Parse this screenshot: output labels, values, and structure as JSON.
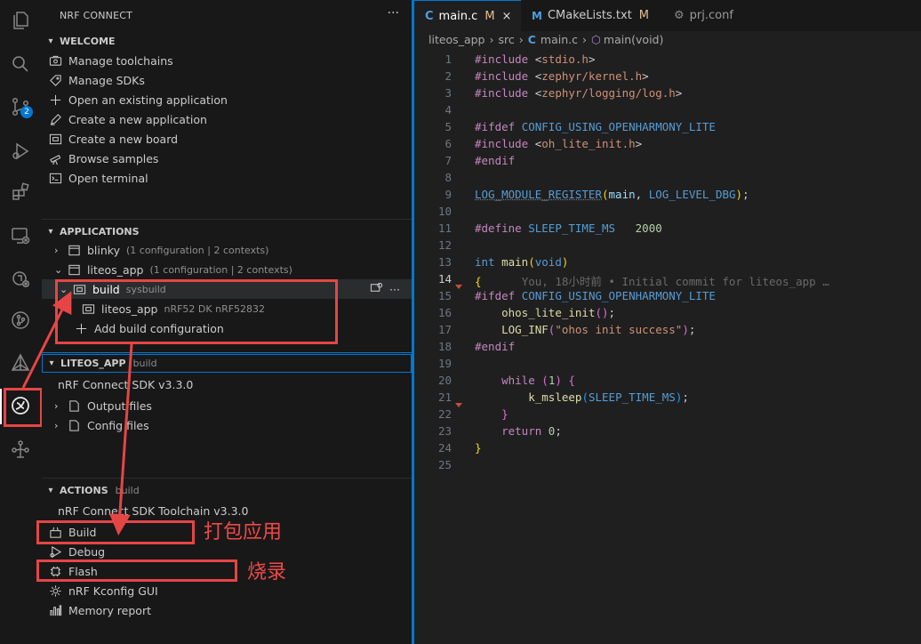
{
  "sidebar": {
    "title": "NRF CONNECT",
    "more": "···",
    "welcome": {
      "header": "WELCOME",
      "items": [
        "Manage toolchains",
        "Manage SDKs",
        "Open an existing application",
        "Create a new application",
        "Create a new board",
        "Browse samples",
        "Open terminal"
      ]
    },
    "applications": {
      "header": "APPLICATIONS",
      "blinky": {
        "label": "blinky",
        "desc": "(1 configuration | 2 contexts)"
      },
      "liteos": {
        "label": "liteos_app",
        "desc": "(1 configuration | 2 contexts)"
      },
      "build": {
        "label": "build",
        "desc": "sysbuild"
      },
      "liteos_child": {
        "label": "liteos_app",
        "desc": "nRF52 DK nRF52832"
      },
      "add_build": "Add build configuration"
    },
    "details": {
      "header": "LITEOS_APP",
      "sub": "build",
      "sdk": "nRF Connect SDK v3.3.0",
      "output": "Output files",
      "config": "Config files"
    },
    "actions": {
      "header": "ACTIONS",
      "sub": "build",
      "toolchain": "nRF Connect SDK Toolchain v3.3.0",
      "items": [
        "Build",
        "Debug",
        "Flash",
        "nRF Kconfig GUI",
        "Memory report"
      ]
    },
    "annotations": {
      "build": "打包应用",
      "flash": "烧录"
    }
  },
  "editor": {
    "tabs": [
      {
        "label": "main.c",
        "status": "M",
        "close": "×"
      },
      {
        "label": "CMakeLists.txt",
        "status": "M"
      },
      {
        "label": "prj.conf"
      }
    ],
    "breadcrumbs": [
      "liteos_app",
      "src",
      "main.c",
      "main(void)"
    ],
    "blame": "You, 18小时前 • Initial commit for liteos_app …",
    "line_numbers": [
      "1",
      "2",
      "3",
      "4",
      "5",
      "6",
      "7",
      "8",
      "9",
      "10",
      "11",
      "12",
      "13",
      "14",
      "15",
      "16",
      "17",
      "18",
      "19",
      "20",
      "21",
      "22",
      "23",
      "24",
      "25"
    ],
    "badge_count": "2"
  }
}
